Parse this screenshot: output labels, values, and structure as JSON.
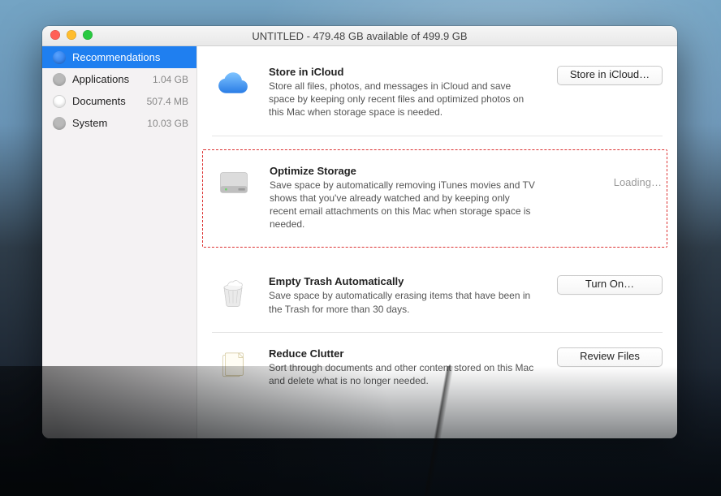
{
  "window": {
    "title": "UNTITLED - 479.48 GB available of 499.9 GB"
  },
  "sidebar": {
    "items": [
      {
        "label": "Recommendations",
        "size": "",
        "selected": true,
        "icon": "recommendations-icon"
      },
      {
        "label": "Applications",
        "size": "1.04 GB",
        "selected": false,
        "icon": "applications-icon"
      },
      {
        "label": "Documents",
        "size": "507.4 MB",
        "selected": false,
        "icon": "documents-icon"
      },
      {
        "label": "System",
        "size": "10.03 GB",
        "selected": false,
        "icon": "system-icon"
      }
    ]
  },
  "recommendations": [
    {
      "id": "icloud",
      "title": "Store in iCloud",
      "description": "Store all files, photos, and messages in iCloud and save space by keeping only recent files and optimized photos on this Mac when storage space is needed.",
      "action_label": "Store in iCloud…",
      "action_state": "button"
    },
    {
      "id": "optimize",
      "title": "Optimize Storage",
      "description": "Save space by automatically removing iTunes movies and TV shows that you've already watched and by keeping only recent email attachments on this Mac when storage space is needed.",
      "action_label": "Loading…",
      "action_state": "loading"
    },
    {
      "id": "trash",
      "title": "Empty Trash Automatically",
      "description": "Save space by automatically erasing items that have been in the Trash for more than 30 days.",
      "action_label": "Turn On…",
      "action_state": "button"
    },
    {
      "id": "clutter",
      "title": "Reduce Clutter",
      "description": "Sort through documents and other content stored on this Mac and delete what is no longer needed.",
      "action_label": "Review Files",
      "action_state": "button"
    }
  ]
}
